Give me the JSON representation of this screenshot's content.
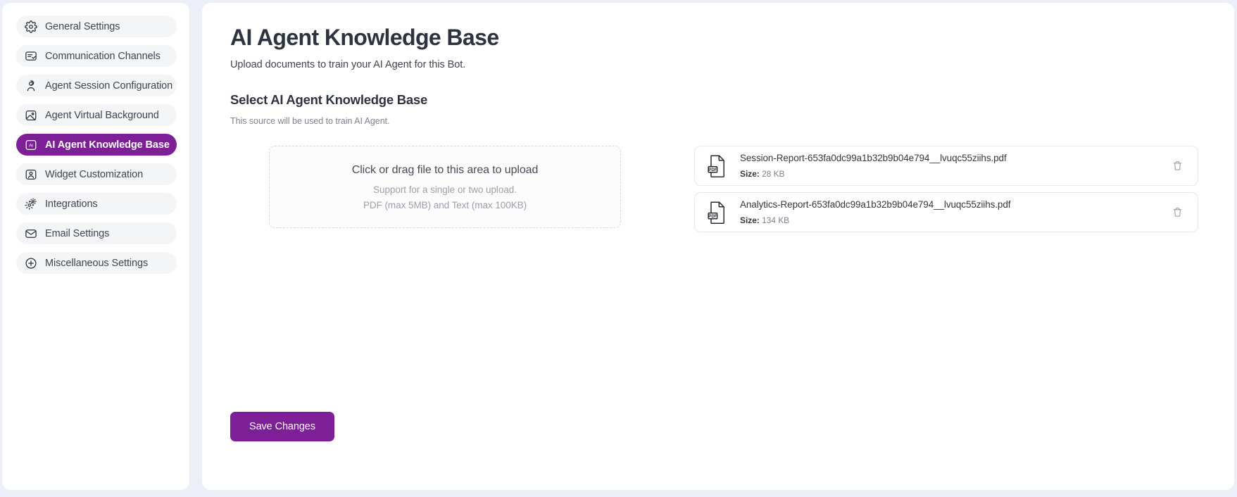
{
  "sidebar": {
    "items": [
      {
        "label": "General Settings",
        "icon": "gear-icon",
        "active": false
      },
      {
        "label": "Communication Channels",
        "icon": "message-check-icon",
        "active": false
      },
      {
        "label": "Agent Session Configuration",
        "icon": "user-gear-icon",
        "active": false
      },
      {
        "label": "Agent Virtual Background",
        "icon": "image-icon",
        "active": false
      },
      {
        "label": "AI Agent Knowledge Base",
        "icon": "ai-badge-icon",
        "active": true
      },
      {
        "label": "Widget Customization",
        "icon": "user-square-icon",
        "active": false
      },
      {
        "label": "Integrations",
        "icon": "gears-icon",
        "active": false
      },
      {
        "label": "Email Settings",
        "icon": "envelope-icon",
        "active": false
      },
      {
        "label": "Miscellaneous Settings",
        "icon": "plus-circle-icon",
        "active": false
      }
    ]
  },
  "main": {
    "title": "AI Agent Knowledge Base",
    "subtitle": "Upload documents to train your AI Agent for this Bot.",
    "section_title": "Select AI Agent Knowledge Base",
    "section_desc": "This source will be used to train AI Agent.",
    "dropzone": {
      "primary": "Click or drag file to this area to upload",
      "secondary": "Support for a single or two upload.",
      "tertiary": "PDF (max 5MB) and Text (max 100KB)"
    },
    "files": [
      {
        "name": "Session-Report-653fa0dc99a1b32b9b04e794__lvuqc55ziihs.pdf",
        "size_label": "Size:",
        "size_value": "28 KB",
        "type_badge": "PDF",
        "delete_icon": "trash-icon"
      },
      {
        "name": "Analytics-Report-653fa0dc99a1b32b9b04e794__lvuqc55ziihs.pdf",
        "size_label": "Size:",
        "size_value": "134 KB",
        "type_badge": "PDF",
        "delete_icon": "trash-icon"
      }
    ],
    "save_label": "Save Changes"
  },
  "colors": {
    "accent_purple": "#7d1f96",
    "page_background": "#eceff7",
    "card_background": "#ffffff",
    "nav_item_background": "#f4f5f7"
  }
}
